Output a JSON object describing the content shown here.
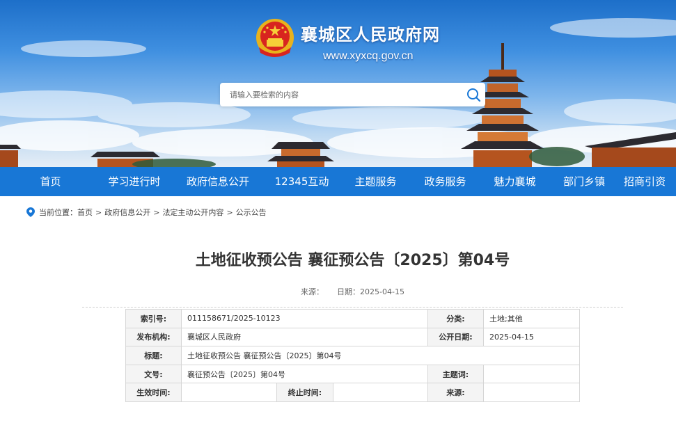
{
  "site": {
    "title": "襄城区人民政府网",
    "url": "www.xyxcq.gov.cn"
  },
  "search": {
    "placeholder": "请输入要检索的内容",
    "icon": "search-icon"
  },
  "nav": {
    "items": [
      "首页",
      "学习进行时",
      "政府信息公开",
      "12345互动",
      "主题服务",
      "政务服务",
      "魅力襄城",
      "部门乡镇",
      "招商引资"
    ]
  },
  "breadcrumb": {
    "prefix": "当前位置：",
    "items": [
      "首页",
      "政府信息公开",
      "法定主动公开内容",
      "公示公告"
    ],
    "separator": ">"
  },
  "article": {
    "title": "土地征收预公告 襄征预公告〔2025〕第04号",
    "source_label": "来源：",
    "source_value": "",
    "date_label": "日期：",
    "date_value": "2025-04-15"
  },
  "info_table": {
    "index_label": "索引号:",
    "index_value": "011158671/2025-10123",
    "category_label": "分类:",
    "category_value": "土地;其他",
    "publisher_label": "发布机构:",
    "publisher_value": "襄城区人民政府",
    "pubdate_label": "公开日期:",
    "pubdate_value": "2025-04-15",
    "title_label": "标题:",
    "title_value": "土地征收预公告 襄征预公告〔2025〕第04号",
    "docno_label": "文号:",
    "docno_value": "襄征预公告〔2025〕第04号",
    "keywords_label": "主题词:",
    "keywords_value": "",
    "effective_label": "生效时间:",
    "effective_value": "",
    "expiry_label": "终止时间:",
    "expiry_value": "",
    "source_label": "来源:",
    "source_value": ""
  },
  "colors": {
    "nav_bg": "#1877d6",
    "accent": "#1877d6",
    "label_bg": "#f4f4f4"
  }
}
